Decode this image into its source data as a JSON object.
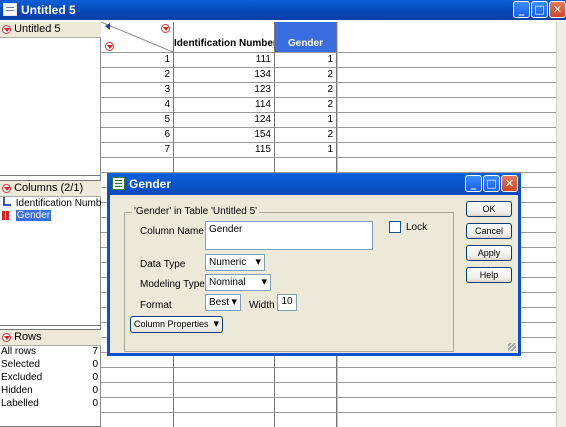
{
  "window": {
    "title": "Untitled 5"
  },
  "left_pane": {
    "table_name": "Untitled 5",
    "columns_header": "Columns (2/1)",
    "columns": [
      {
        "name": "Identification Numb"
      },
      {
        "name": "Gender"
      }
    ],
    "rows_header": "Rows",
    "row_states": [
      {
        "label": "All rows",
        "count": "7"
      },
      {
        "label": "Selected",
        "count": "0"
      },
      {
        "label": "Excluded",
        "count": "0"
      },
      {
        "label": "Hidden",
        "count": "0"
      },
      {
        "label": "Labelled",
        "count": "0"
      }
    ]
  },
  "table": {
    "headers": [
      "Identification Number",
      "Gender"
    ],
    "rows": [
      {
        "n": "1",
        "id": "111",
        "gender": "1"
      },
      {
        "n": "2",
        "id": "134",
        "gender": "2"
      },
      {
        "n": "3",
        "id": "123",
        "gender": "2"
      },
      {
        "n": "4",
        "id": "114",
        "gender": "2"
      },
      {
        "n": "5",
        "id": "124",
        "gender": "1"
      },
      {
        "n": "6",
        "id": "154",
        "gender": "2"
      },
      {
        "n": "7",
        "id": "115",
        "gender": "1"
      }
    ]
  },
  "dialog": {
    "title": "Gender",
    "group_label": "'Gender' in Table 'Untitled 5'",
    "column_name_label": "Column Name",
    "column_name_value": "Gender",
    "lock_label": "Lock",
    "data_type_label": "Data Type",
    "data_type_value": "Numeric",
    "modeling_type_label": "Modeling Type",
    "modeling_type_value": "Nominal",
    "format_label": "Format",
    "format_value": "Best",
    "width_label": "Width",
    "width_value": "10",
    "column_properties": "Column Properties",
    "buttons": {
      "ok": "OK",
      "cancel": "Cancel",
      "apply": "Apply",
      "help": "Help"
    }
  },
  "colors": {
    "selected_column_header": "#3a6ee0",
    "titlebar": "#0a4fd0"
  }
}
